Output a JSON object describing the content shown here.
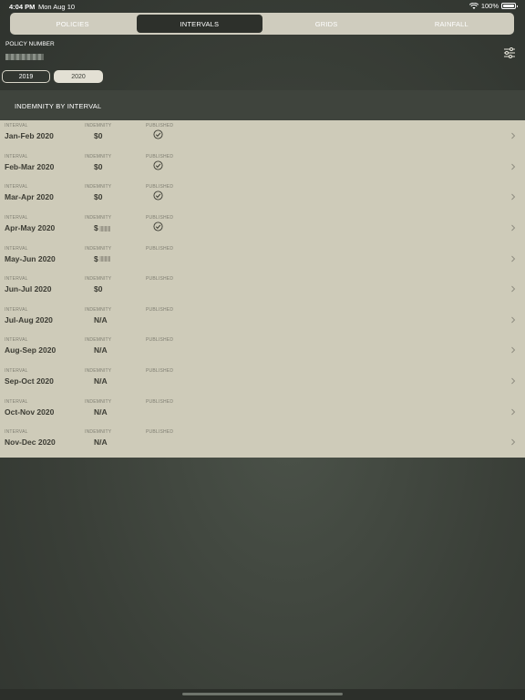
{
  "statusbar": {
    "time": "4:04 PM",
    "date": "Mon Aug 10",
    "battery": "100%"
  },
  "tabs": [
    {
      "label": "POLICIES",
      "active": false
    },
    {
      "label": "INTERVALS",
      "active": true
    },
    {
      "label": "GRIDS",
      "active": false
    },
    {
      "label": "RAINFALL",
      "active": false
    }
  ],
  "policy": {
    "label": "POLICY NUMBER"
  },
  "years": [
    {
      "label": "2019",
      "selected": false
    },
    {
      "label": "2020",
      "selected": true
    }
  ],
  "section": {
    "title": "INDEMNITY BY INTERVAL"
  },
  "columns": {
    "interval": "INTERVAL",
    "indemnity": "INDEMNITY",
    "published": "PUBLISHED"
  },
  "rows": [
    {
      "interval": "Jan-Feb 2020",
      "indemnity": "$0",
      "published": true
    },
    {
      "interval": "Feb-Mar 2020",
      "indemnity": "$0",
      "published": true
    },
    {
      "interval": "Mar-Apr 2020",
      "indemnity": "$0",
      "published": true
    },
    {
      "interval": "Apr-May 2020",
      "indemnity": "$",
      "indemnity_redacted": true,
      "published": true
    },
    {
      "interval": "May-Jun 2020",
      "indemnity": "$",
      "indemnity_redacted": true,
      "published": false
    },
    {
      "interval": "Jun-Jul 2020",
      "indemnity": "$0",
      "published": false
    },
    {
      "interval": "Jul-Aug 2020",
      "indemnity": "N/A",
      "published": false
    },
    {
      "interval": "Aug-Sep 2020",
      "indemnity": "N/A",
      "published": false
    },
    {
      "interval": "Sep-Oct 2020",
      "indemnity": "N/A",
      "published": false
    },
    {
      "interval": "Oct-Nov 2020",
      "indemnity": "N/A",
      "published": false
    },
    {
      "interval": "Nov-Dec 2020",
      "indemnity": "N/A",
      "published": false
    }
  ],
  "colors": {
    "accent": "#2d302b",
    "panel": "#cecbb9",
    "background": "#3a3f38"
  },
  "icons": {
    "published": "check-circle-icon",
    "row_action": "chevron-right-icon",
    "filter": "sliders-icon"
  }
}
